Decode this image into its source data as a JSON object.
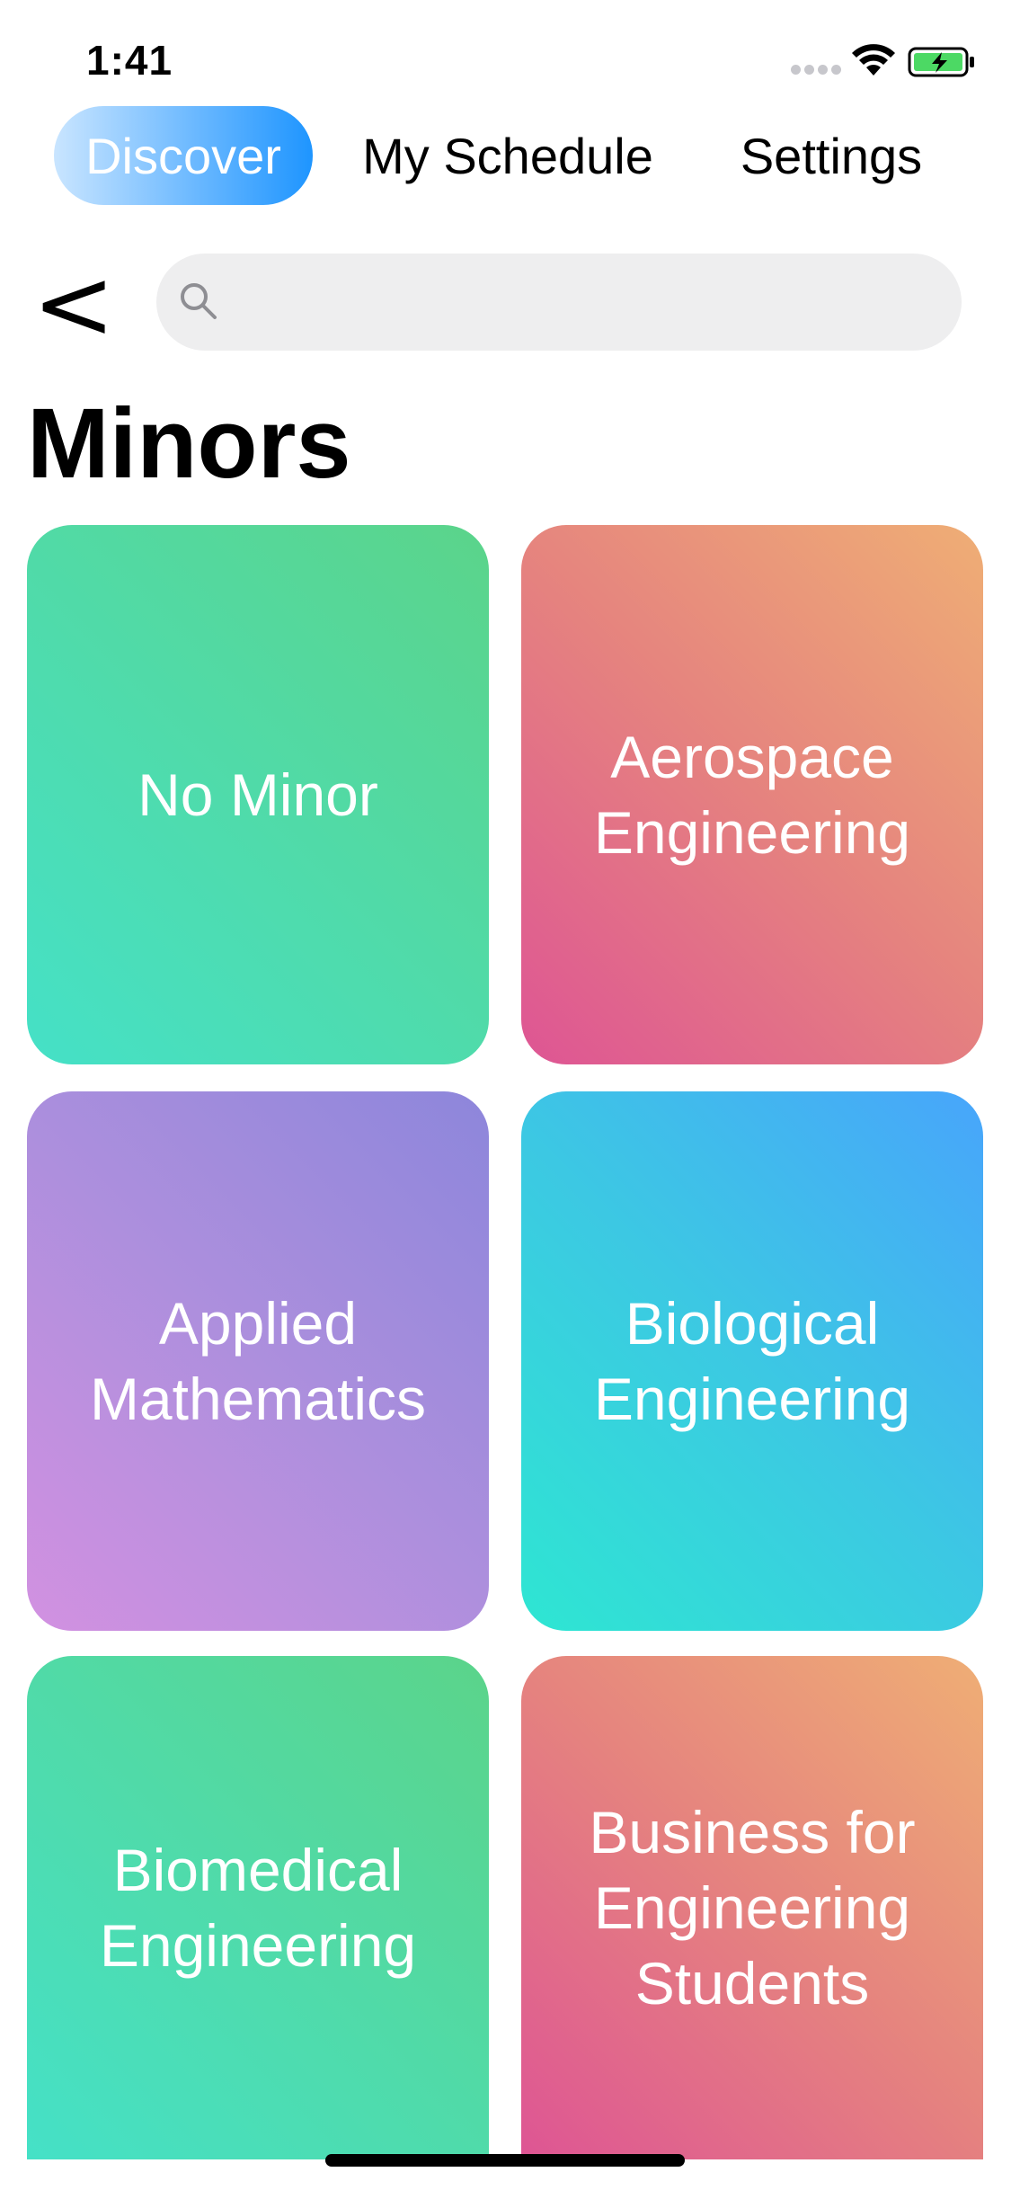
{
  "status_bar": {
    "time": "1:41"
  },
  "tabs": [
    {
      "label": "Discover",
      "active": true
    },
    {
      "label": "My Schedule",
      "active": false
    },
    {
      "label": "Settings",
      "active": false
    }
  ],
  "nav": {
    "back_label": "<"
  },
  "search": {
    "placeholder": "",
    "value": ""
  },
  "page": {
    "title": "Minors"
  },
  "minors": [
    {
      "label": "No Minor",
      "gradient": "green",
      "colors": [
        "#45e1c7",
        "#5bd48a"
      ]
    },
    {
      "label": "Aerospace\nEngineering",
      "gradient": "coral",
      "colors": [
        "#de5594",
        "#efae75"
      ]
    },
    {
      "label": "Applied\nMathematics",
      "gradient": "purple",
      "colors": [
        "#d291e1",
        "#8d86db"
      ]
    },
    {
      "label": "Biological\nEngineering",
      "gradient": "blue",
      "colors": [
        "#2ee6d2",
        "#48a5fb"
      ]
    },
    {
      "label": "Biomedical\nEngineering",
      "gradient": "green",
      "colors": [
        "#45e1c7",
        "#5bd48a"
      ]
    },
    {
      "label": "Business for\nEngineering\nStudents",
      "gradient": "coral",
      "colors": [
        "#de5594",
        "#efae75"
      ]
    }
  ],
  "colors": {
    "active_tab": "#1e95ff",
    "search_bg": "#eeeeef",
    "battery_fill": "#4cd964"
  }
}
